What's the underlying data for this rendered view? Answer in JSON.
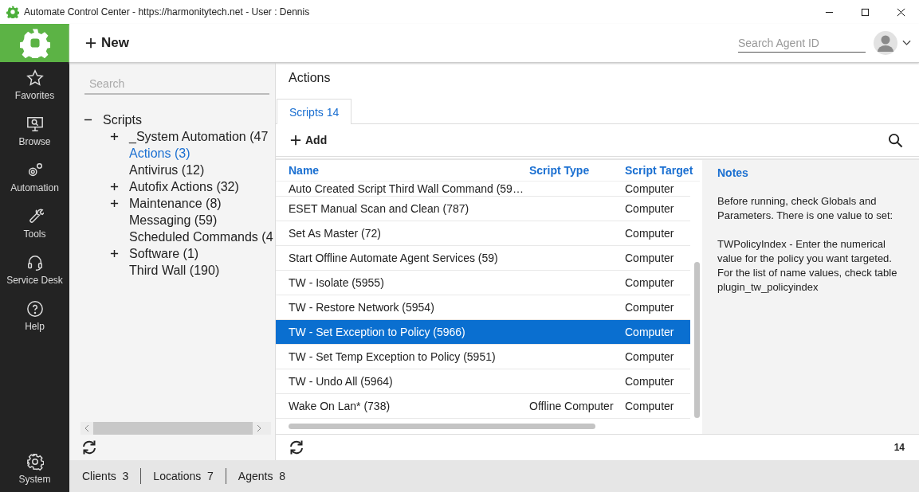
{
  "window": {
    "title": "Automate Control Center - https://harmonitytech.net - User : Dennis"
  },
  "toolbar": {
    "new_label": "New",
    "search": {
      "placeholder": "Search Agent ID"
    }
  },
  "nav": [
    {
      "label": "Favorites"
    },
    {
      "label": "Browse"
    },
    {
      "label": "Automation"
    },
    {
      "label": "Tools"
    },
    {
      "label": "Service Desk"
    },
    {
      "label": "Help"
    }
  ],
  "nav_bottom": {
    "label": "System"
  },
  "tree": {
    "search": {
      "placeholder": "Search"
    },
    "items": [
      {
        "label": "Scripts",
        "kind": "folder",
        "expanded": true,
        "selected": false,
        "children": [
          {
            "label": "_System Automation (47",
            "kind": "folder",
            "expanded": false,
            "selected": false
          },
          {
            "label": "Actions (3)",
            "kind": "leaf",
            "selected": true
          },
          {
            "label": "Antivirus (12)",
            "kind": "leaf",
            "selected": false
          },
          {
            "label": "Autofix Actions (32)",
            "kind": "folder",
            "expanded": false,
            "selected": false
          },
          {
            "label": "Maintenance (8)",
            "kind": "folder",
            "expanded": false,
            "selected": false
          },
          {
            "label": "Messaging (59)",
            "kind": "leaf",
            "selected": false
          },
          {
            "label": "Scheduled Commands (4",
            "kind": "leaf",
            "selected": false
          },
          {
            "label": "Software (1)",
            "kind": "folder",
            "expanded": false,
            "selected": false
          },
          {
            "label": "Third Wall (190)",
            "kind": "leaf",
            "selected": false
          }
        ]
      }
    ]
  },
  "main": {
    "title": "Actions",
    "tabs": [
      {
        "label": "Scripts 14",
        "selected": true
      }
    ],
    "add_label": "Add",
    "table": {
      "columns": [
        "Name",
        "Script Type",
        "Script Target"
      ],
      "rows": [
        {
          "name": "Auto Created Script Third Wall Command (59…",
          "target": "Computer",
          "selected": false
        },
        {
          "name": "ESET Manual Scan and Clean (787)",
          "target": "Computer",
          "selected": false
        },
        {
          "name": "Set As Master (72)",
          "target": "Computer",
          "selected": false
        },
        {
          "name": "Start Offline Automate Agent Services (59)",
          "target": "Computer",
          "selected": false
        },
        {
          "name": "TW - Isolate (5955)",
          "target": "Computer",
          "selected": false
        },
        {
          "name": "TW - Restore Network (5954)",
          "target": "Computer",
          "selected": false
        },
        {
          "name": "TW - Set Exception to Policy (5966)",
          "target": "Computer",
          "selected": true
        },
        {
          "name": "TW - Set Temp Exception to Policy (5951)",
          "target": "Computer",
          "selected": false
        },
        {
          "name": "TW - Undo All (5964)",
          "target": "Computer",
          "selected": false
        },
        {
          "name": "Wake On Lan* (738)",
          "type": "Offline Computer",
          "target": "Computer",
          "selected": false
        }
      ]
    },
    "count": "14",
    "notes": {
      "title": "Notes",
      "paragraphs": [
        "Before running, check Globals and Parameters.  There is one value to set:",
        "TWPolicyIndex - Enter the numerical value for the policy you want targeted.  For the list of name values, check table plugin_tw_policyindex"
      ]
    }
  },
  "status_bar": [
    {
      "label": "Clients",
      "value": "3"
    },
    {
      "label": "Locations",
      "value": "7"
    },
    {
      "label": "Agents",
      "value": "8"
    }
  ]
}
